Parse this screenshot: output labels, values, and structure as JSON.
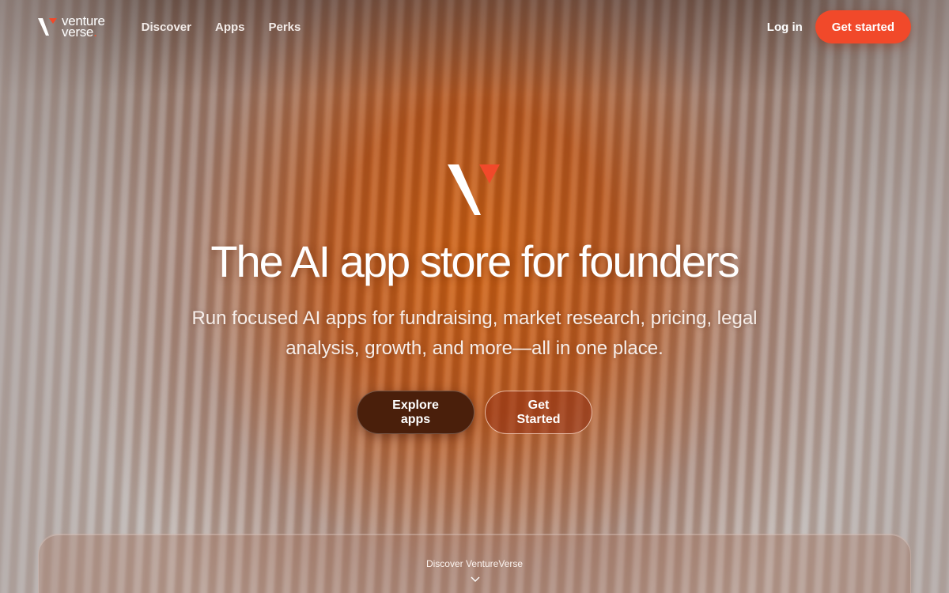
{
  "brand": {
    "line1": "venture",
    "line2": "verse",
    "dot": ".",
    "accent_color": "#f1492a"
  },
  "nav": {
    "links": [
      {
        "label": "Discover"
      },
      {
        "label": "Apps"
      },
      {
        "label": "Perks"
      }
    ],
    "login_label": "Log in",
    "cta_label": "Get started"
  },
  "hero": {
    "icon": "venture-verse-logo-mark",
    "title": "The AI app store for founders",
    "subtitle": "Run focused AI apps for fundraising, market research, pricing, legal analysis, growth, and more—all in one place.",
    "primary_button": "Explore apps",
    "secondary_button": "Get Started"
  },
  "discover": {
    "label": "Discover VentureVerse",
    "icon": "chevron-down-icon"
  }
}
